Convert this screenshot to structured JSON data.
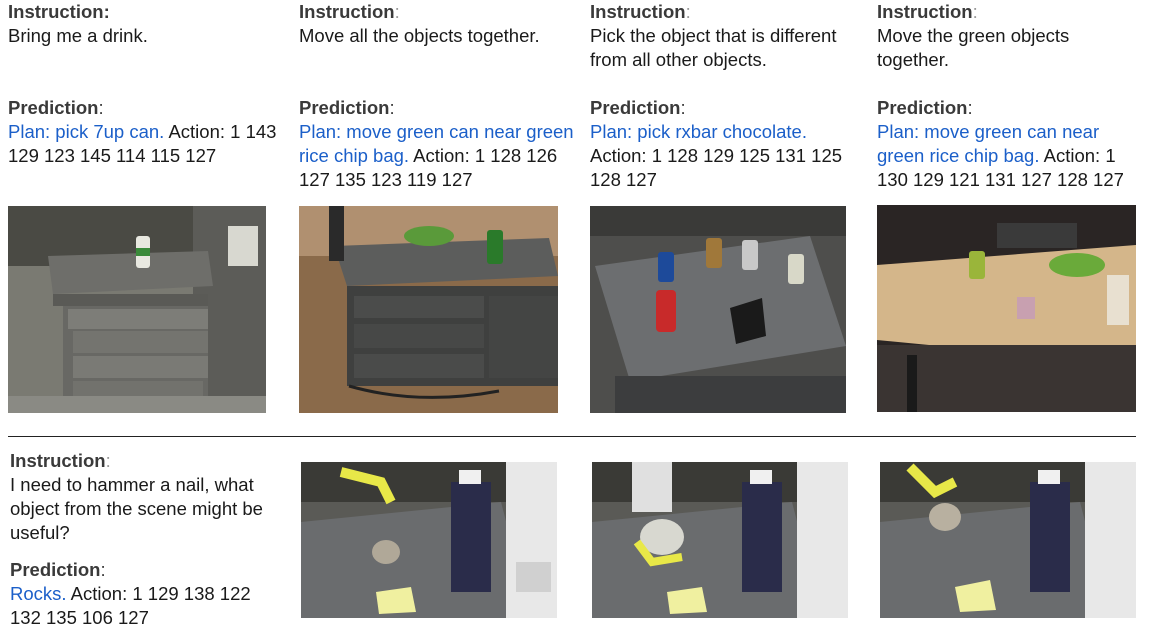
{
  "colors": {
    "plan_blue": "#1b5fc9",
    "label_gray": "#3a3a3a",
    "colon_gray": "#9a9a9a"
  },
  "labels": {
    "instruction": "Instruction",
    "prediction": "Prediction",
    "colon": ":"
  },
  "panels": [
    {
      "instruction": "Bring me a drink.",
      "plan": "Plan: pick 7up can.",
      "action": " Action: 1 143 129 123 145 114 115 127",
      "scene": "gray cabinet with drawers, 7up can on top"
    },
    {
      "instruction": "Move all the objects together.",
      "plan": "Plan: move green can near green rice chip bag.",
      "action": " Action: 1 128 126 127 135 123 119 127",
      "scene": "dark cabinet with green can and chip bag"
    },
    {
      "instruction": "Pick the object that is different from all other objects.",
      "plan": "Plan: pick rxbar chocolate.",
      "action": " Action: 1 128 129 125 131 125 128 127",
      "scene": "gray table with cans and rxbar"
    },
    {
      "instruction": "Move the green objects together.",
      "plan": "Plan: move green can near green rice chip bag.",
      "action": " Action: 1 130 129 121 131 127 128 127",
      "scene": "wooden desk with green can, chip bag and bar"
    }
  ],
  "bottom": {
    "instruction": "I need to hammer a nail, what object from the scene might be useful?",
    "plan": "Rocks.",
    "action": " Action: 1 129 138 122 132 135 106 127",
    "frames": [
      "robot gripper approaching rock",
      "robot gripper grasping rock",
      "robot gripper lifting rock"
    ]
  }
}
